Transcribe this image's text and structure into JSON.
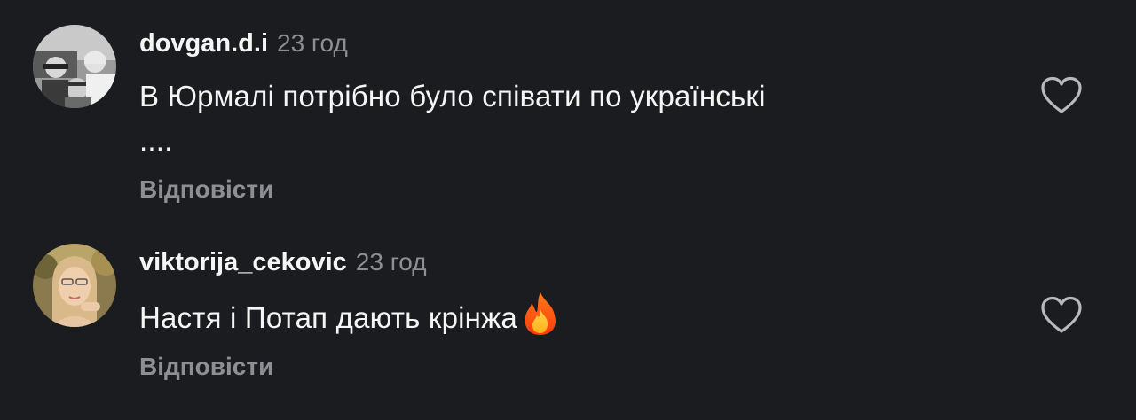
{
  "comments": [
    {
      "username": "dovgan.d.i",
      "time": "23 год",
      "text_line1": "В Юрмалі потрібно було співати по українські",
      "text_line2": "....",
      "reply_label": "Відповісти",
      "avatar_icon": "avatar-photo-group",
      "like_icon": "heart-outline-icon"
    },
    {
      "username": "viktorija_cekovic",
      "time": "23 год",
      "text": "Настя і Потап дають крінжа",
      "emoji_icon": "fire-icon",
      "reply_label": "Відповісти",
      "avatar_icon": "avatar-photo-woman",
      "like_icon": "heart-outline-icon"
    }
  ],
  "colors": {
    "background": "#1b1c20",
    "primary_text": "#f5f5f5",
    "secondary_text": "#8e8e93"
  }
}
